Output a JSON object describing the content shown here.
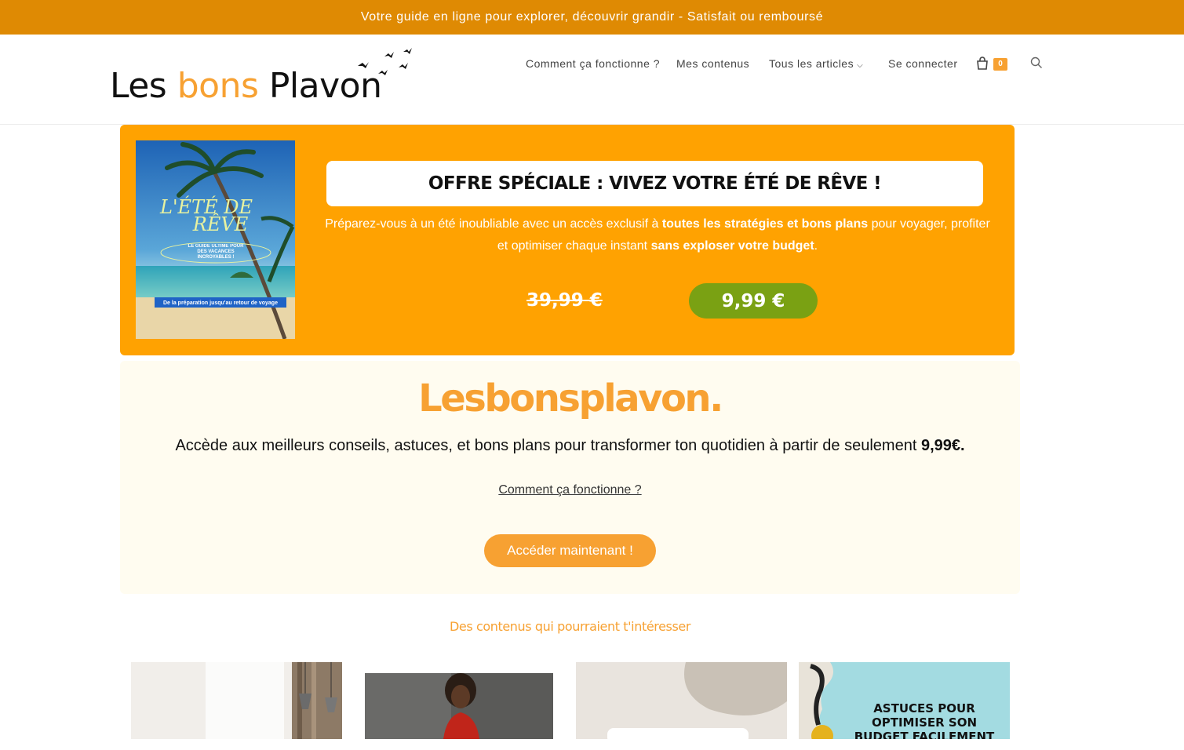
{
  "topbar": {
    "text": "Votre guide en ligne pour explorer, découvrir grandir - Satisfait ou remboursé"
  },
  "header": {
    "logo": {
      "part1": "Les ",
      "part2": "bons",
      "part3": " Plavon"
    },
    "nav": [
      {
        "label": "Comment ça fonctionne ?"
      },
      {
        "label": "Mes contenus"
      },
      {
        "label": "Tous les articles"
      },
      {
        "label": "Se connecter"
      }
    ],
    "cart_count": "0"
  },
  "promo": {
    "book": {
      "title_line1": "L'ÉTÉ DE",
      "title_line2": "RÊVE",
      "subtitle": "LE GUIDE ULTIME POUR DES VACANCES INCROYABLES !",
      "footer": "De la préparation jusqu'au retour de voyage"
    },
    "title": "OFFRE SPÉCIALE : VIVEZ VOTRE ÉTÉ DE RÊVE !",
    "desc_1": "Préparez-vous à un été inoubliable avec un accès exclusif à ",
    "desc_bold_1": "toutes les stratégies et bons plans",
    "desc_2": " pour voyager, profiter et optimiser chaque instant ",
    "desc_bold_2": "sans exploser votre budget",
    "desc_3": ".",
    "old_price": "39,99 €",
    "new_price": "9,99 €"
  },
  "hero": {
    "brand": "Lesbonsplavon.",
    "text": "Accède aux meilleurs conseils, astuces, et bons plans pour transformer ton quotidien à partir de seulement ",
    "text_bold": "9,99€.",
    "link": "Comment ça fonctionne ?",
    "button": "Accéder maintenant !"
  },
  "related": {
    "title": "Des contenus qui pourraient t'intéresser",
    "card4_text": "ASTUCES POUR OPTIMISER SON BUDGET FACILEMENT"
  },
  "colors": {
    "topbar": "#df8a03",
    "accent": "#f7a132",
    "promo_bg": "#ffa201",
    "price_green": "#7aa113",
    "hero_bg": "#fffcf0"
  }
}
